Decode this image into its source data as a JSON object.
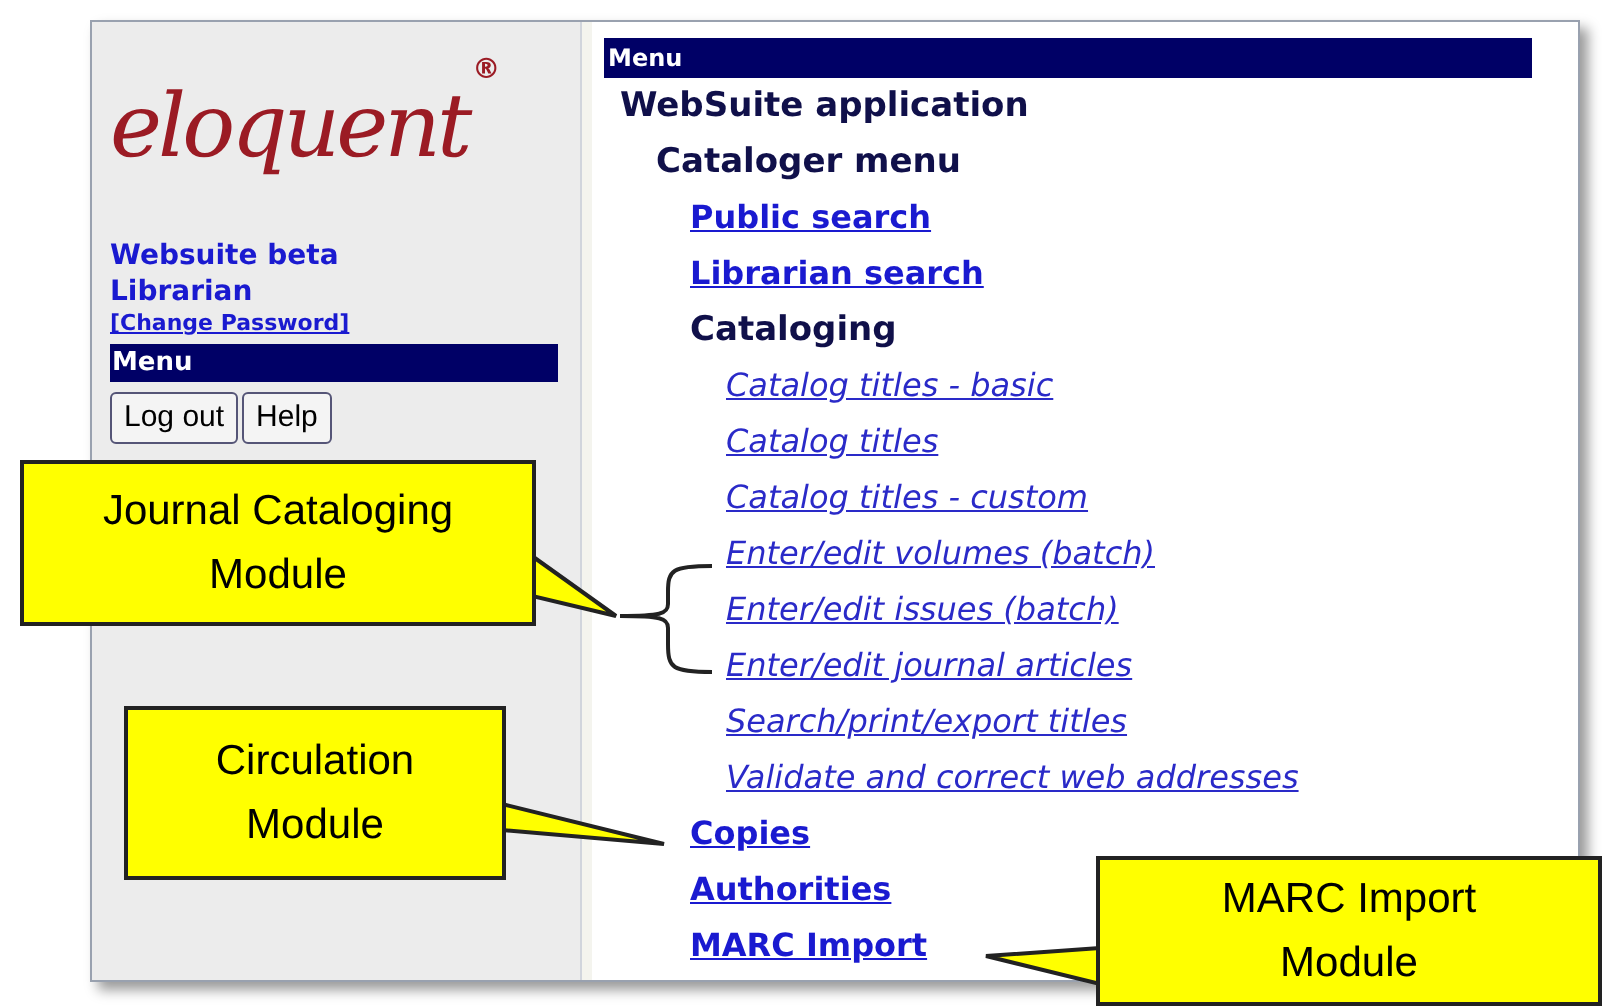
{
  "sidebar": {
    "logo": "eloquent",
    "registered_mark": "®",
    "product": "Websuite beta",
    "role": "Librarian",
    "change_password": "[Change Password]",
    "menu_header": "Menu",
    "buttons": [
      "Log out",
      "Help"
    ]
  },
  "menu": {
    "header": "Menu",
    "items": [
      {
        "label": "WebSuite application",
        "kind": "heading",
        "children": [
          {
            "label": "Cataloger menu",
            "kind": "heading",
            "children": [
              {
                "label": "Public search",
                "kind": "link"
              },
              {
                "label": "Librarian search",
                "kind": "link"
              },
              {
                "label": "Cataloging",
                "kind": "heading",
                "children": [
                  {
                    "label": "Catalog titles - basic",
                    "kind": "sublink"
                  },
                  {
                    "label": "Catalog titles",
                    "kind": "sublink"
                  },
                  {
                    "label": "Catalog titles - custom",
                    "kind": "sublink"
                  },
                  {
                    "label": "Enter/edit volumes (batch)",
                    "kind": "sublink"
                  },
                  {
                    "label": "Enter/edit issues (batch)",
                    "kind": "sublink"
                  },
                  {
                    "label": "Enter/edit journal articles",
                    "kind": "sublink"
                  },
                  {
                    "label": "Search/print/export titles",
                    "kind": "sublink"
                  },
                  {
                    "label": "Validate and correct web addresses",
                    "kind": "sublink"
                  }
                ]
              },
              {
                "label": "Copies",
                "kind": "link"
              },
              {
                "label": "Authorities",
                "kind": "link"
              },
              {
                "label": "MARC Import",
                "kind": "link"
              }
            ]
          }
        ]
      }
    ]
  },
  "callouts": [
    {
      "text": "Journal Cataloging Module"
    },
    {
      "text": "Circulation Module"
    },
    {
      "text": "MARC Import Module"
    }
  ]
}
